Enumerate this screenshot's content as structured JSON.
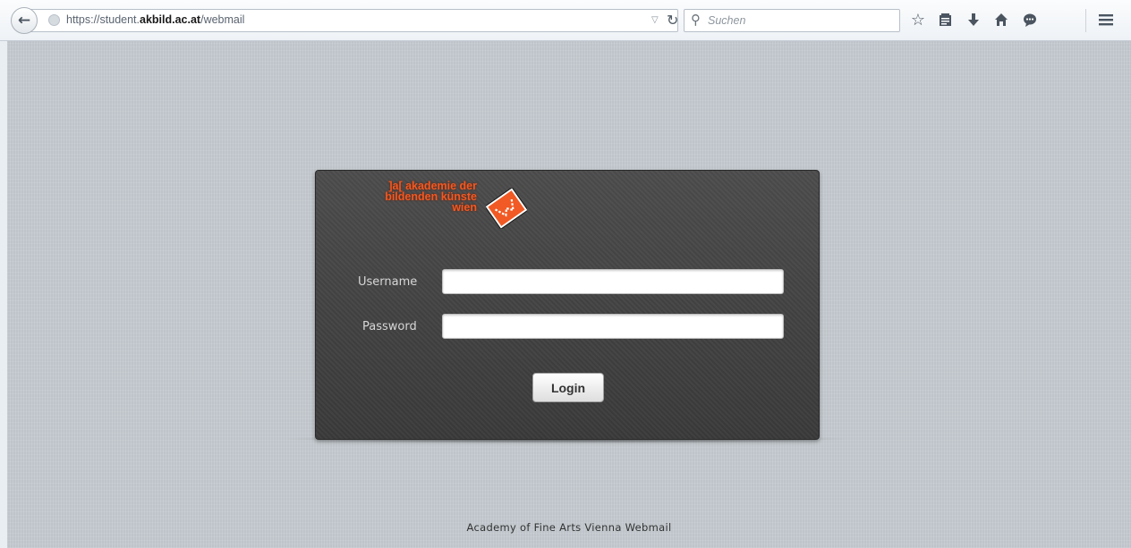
{
  "browser": {
    "url_prefix": "https://student.",
    "url_domain": "akbild.ac.at",
    "url_path": "/webmail",
    "search_placeholder": "Suchen"
  },
  "logo": {
    "line1": "]a[ akademie der",
    "line2": "bildenden künste",
    "line3": "wien",
    "brand_color": "#f15a24"
  },
  "login": {
    "username_label": "Username",
    "password_label": "Password",
    "username_value": "",
    "password_value": "",
    "button_label": "Login"
  },
  "footer": "Academy of Fine Arts Vienna Webmail"
}
